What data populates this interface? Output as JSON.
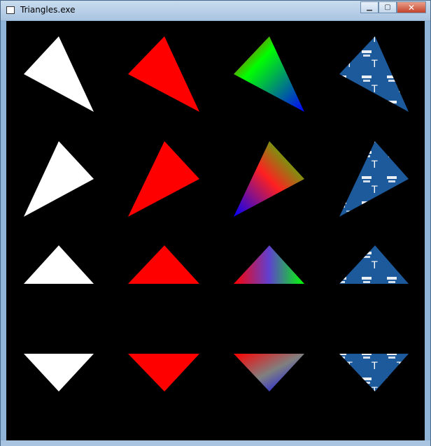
{
  "window": {
    "title": "Triangles.exe",
    "minimize_icon": "minimize-icon",
    "maximize_icon": "maximize-icon",
    "close_icon": "close-icon"
  },
  "scene": {
    "background": "#000000",
    "columns": [
      "solid-white",
      "solid-red",
      "vertex-color-gradient",
      "textured"
    ],
    "colors": {
      "white": "#ffffff",
      "red": "#ff0000",
      "gradient_green": "#00ff00",
      "gradient_blue": "#0000ff",
      "gradient_red": "#ff0000",
      "texture_blue": "#1c5a9c"
    }
  }
}
